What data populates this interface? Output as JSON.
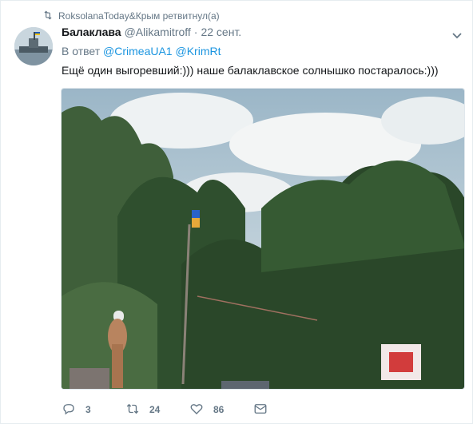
{
  "retweet": {
    "text": "RoksolanaToday&Крым ретвитнул(а)"
  },
  "author": {
    "name": "Балаклава",
    "handle": "@Alikamitroff",
    "separator": "·",
    "time": "22 сент."
  },
  "reply": {
    "prefix": "В ответ",
    "mentions": [
      "@CrimeaUA1",
      "@KrimRt"
    ]
  },
  "tweet": {
    "text": "Ещё один выгоревший:))) наше балаклавское солнышко постаралось:)))"
  },
  "actions": {
    "replies": "3",
    "retweets": "24",
    "likes": "86"
  },
  "colors": {
    "link": "#1b95e0",
    "muted": "#657786",
    "text": "#14171a",
    "border": "#e6ecf0"
  },
  "icons": [
    "retweet-icon",
    "caret-down-icon",
    "reply-icon",
    "retweet-icon",
    "like-icon",
    "direct-message-icon"
  ]
}
